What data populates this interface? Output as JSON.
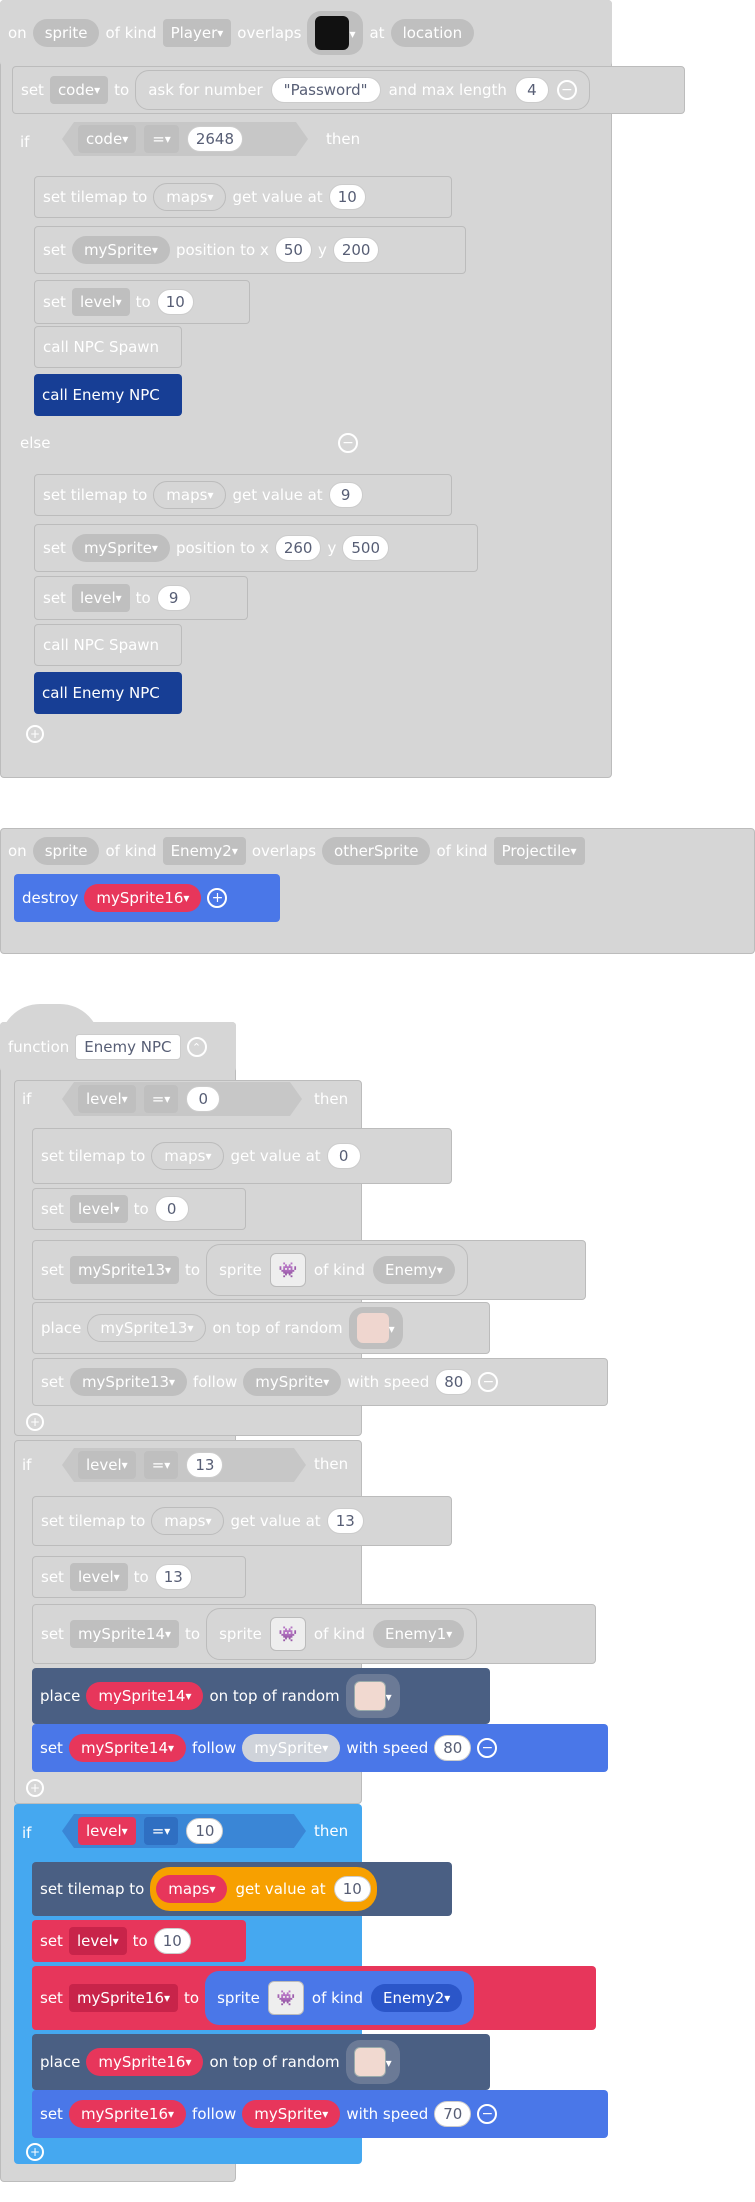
{
  "colors": {
    "grey": "#d6d6d6",
    "blue": "#4a77e8",
    "red": "#e7365b",
    "slate": "#4a5f83",
    "navy": "#173e95",
    "lightblue": "#45a8f0",
    "orange": "#f7a000"
  },
  "ev1": {
    "on": "on",
    "sprite": "sprite",
    "of_kind": "of kind",
    "kind": "Player",
    "overlaps": "overlaps",
    "at": "at",
    "location": "location",
    "set": "set",
    "code_var": "code",
    "to": "to",
    "ask": "ask for number",
    "password": "Password",
    "and_max": "and max length",
    "maxlen": "4",
    "if": "if",
    "eq": "=",
    "value": "2648",
    "then": "then",
    "else": "else",
    "set_tilemap": "set tilemap to",
    "maps": "maps",
    "get_value_at": "get value at",
    "a_tile": "10",
    "a_sprite": "mySprite",
    "position_to_x": "position to x",
    "y": "y",
    "a_x": "50",
    "a_y": "200",
    "level": "level",
    "a_level": "10",
    "call_spawn": "call NPC Spawn",
    "call_enemy": "call Enemy NPC",
    "b_tile": "9",
    "b_x": "260",
    "b_y": "500",
    "b_level": "9"
  },
  "ev2": {
    "on": "on",
    "sprite": "sprite",
    "of_kind": "of kind",
    "kind": "Enemy2",
    "overlaps": "overlaps",
    "other": "otherSprite",
    "kind2": "Projectile",
    "destroy": "destroy",
    "target": "mySprite16"
  },
  "func": {
    "function": "function",
    "name": "Enemy NPC",
    "if": "if",
    "level": "level",
    "eq": "=",
    "then": "then",
    "set_tilemap": "set tilemap to",
    "maps": "maps",
    "get_value_at": "get value at",
    "set": "set",
    "to": "to",
    "sprite": "sprite",
    "of_kind": "of kind",
    "place": "place",
    "on_top": "on top of random",
    "follow": "follow",
    "with_speed": "with speed",
    "my_sprite": "mySprite",
    "c1": {
      "cond": "0",
      "tile": "0",
      "level": "0",
      "var": "mySprite13",
      "kind": "Enemy",
      "speed": "80"
    },
    "c2": {
      "cond": "13",
      "tile": "13",
      "level": "13",
      "var": "mySprite14",
      "kind": "Enemy1",
      "speed": "80"
    },
    "c3": {
      "cond": "10",
      "tile": "10",
      "level": "10",
      "var": "mySprite16",
      "kind": "Enemy2",
      "speed": "70"
    }
  }
}
